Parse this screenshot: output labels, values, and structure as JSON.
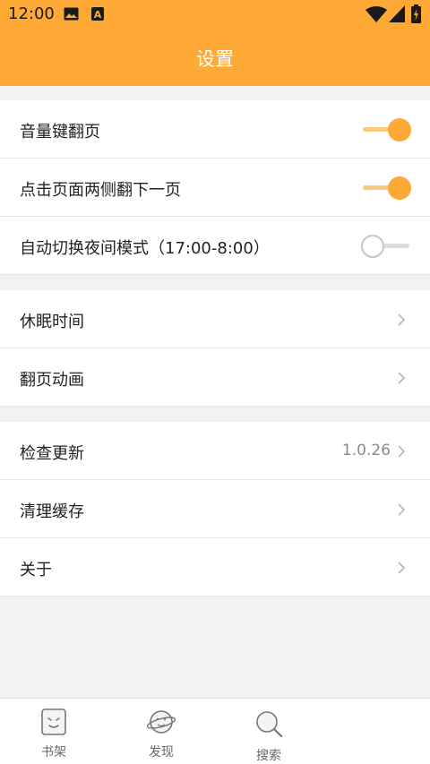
{
  "colors": {
    "accent": "#fea935",
    "status_bar": "#fea935",
    "background": "#f2f2f2"
  },
  "status_bar": {
    "time": "12:00",
    "icons": [
      "image-icon",
      "a-icon",
      "wifi-icon",
      "signal-icon",
      "battery-icon"
    ]
  },
  "header": {
    "title": "设置"
  },
  "settings": {
    "toggles": [
      {
        "label": "音量键翻页",
        "enabled": true
      },
      {
        "label": "点击页面两侧翻下一页",
        "enabled": true
      },
      {
        "label": "自动切换夜间模式（17:00-8:00）",
        "enabled": false
      }
    ],
    "reading": [
      {
        "label": "休眠时间"
      },
      {
        "label": "翻页动画"
      }
    ],
    "app": [
      {
        "label": "检查更新",
        "value": "1.0.26"
      },
      {
        "label": "清理缓存"
      },
      {
        "label": "关于"
      }
    ]
  },
  "bottom_nav": [
    {
      "label": "书架",
      "icon": "bookshelf-icon"
    },
    {
      "label": "发现",
      "icon": "planet-icon"
    },
    {
      "label": "搜索",
      "icon": "search-icon"
    }
  ]
}
